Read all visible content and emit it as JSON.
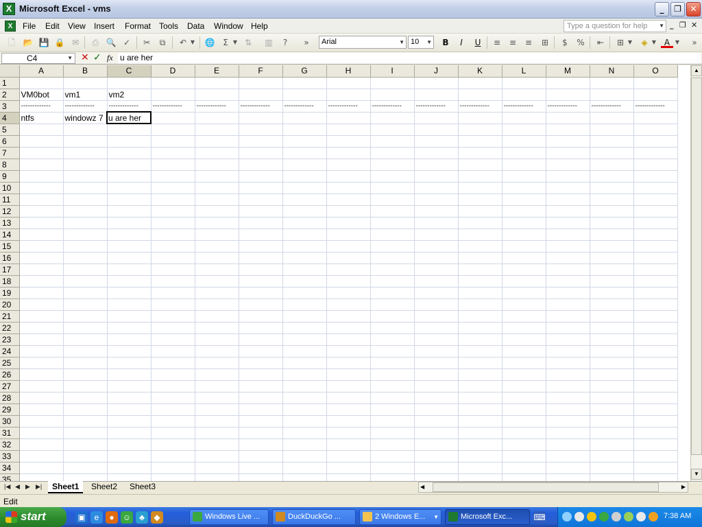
{
  "window": {
    "title": "Microsoft Excel - vms",
    "app_icon": "excel-icon"
  },
  "menu": [
    "File",
    "Edit",
    "View",
    "Insert",
    "Format",
    "Tools",
    "Data",
    "Window",
    "Help"
  ],
  "help_box": {
    "placeholder": "Type a question for help"
  },
  "toolbar": {
    "font_name": "Arial",
    "font_size": "10",
    "bold": "B",
    "italic": "I",
    "underline": "U"
  },
  "formula": {
    "name_box": "C4",
    "fx": "fx",
    "content": "u are her"
  },
  "columns": [
    "A",
    "B",
    "C",
    "D",
    "E",
    "F",
    "G",
    "H",
    "I",
    "J",
    "K",
    "L",
    "M",
    "N",
    "O"
  ],
  "rows": [
    "1",
    "2",
    "3",
    "4",
    "5",
    "6",
    "7",
    "8",
    "9",
    "10",
    "11",
    "12",
    "13",
    "14",
    "15",
    "16",
    "17",
    "18",
    "19",
    "20",
    "21",
    "22",
    "23",
    "24",
    "25",
    "26",
    "27",
    "28",
    "29",
    "30",
    "31",
    "32",
    "33",
    "34",
    "35"
  ],
  "cells": {
    "r2": [
      "VM0bot",
      "vm1",
      "vm2"
    ],
    "dash": "-------------",
    "r4": [
      "ntfs",
      "windowz 7",
      "u are her"
    ]
  },
  "sheets": [
    "Sheet1",
    "Sheet2",
    "Sheet3"
  ],
  "status": "Edit",
  "taskbar": {
    "start": "start",
    "tasks": [
      "Windows Live ...",
      "DuckDuckGo ...",
      "2 Windows E...",
      "Microsoft Exc..."
    ],
    "clock": "7:38 AM"
  }
}
